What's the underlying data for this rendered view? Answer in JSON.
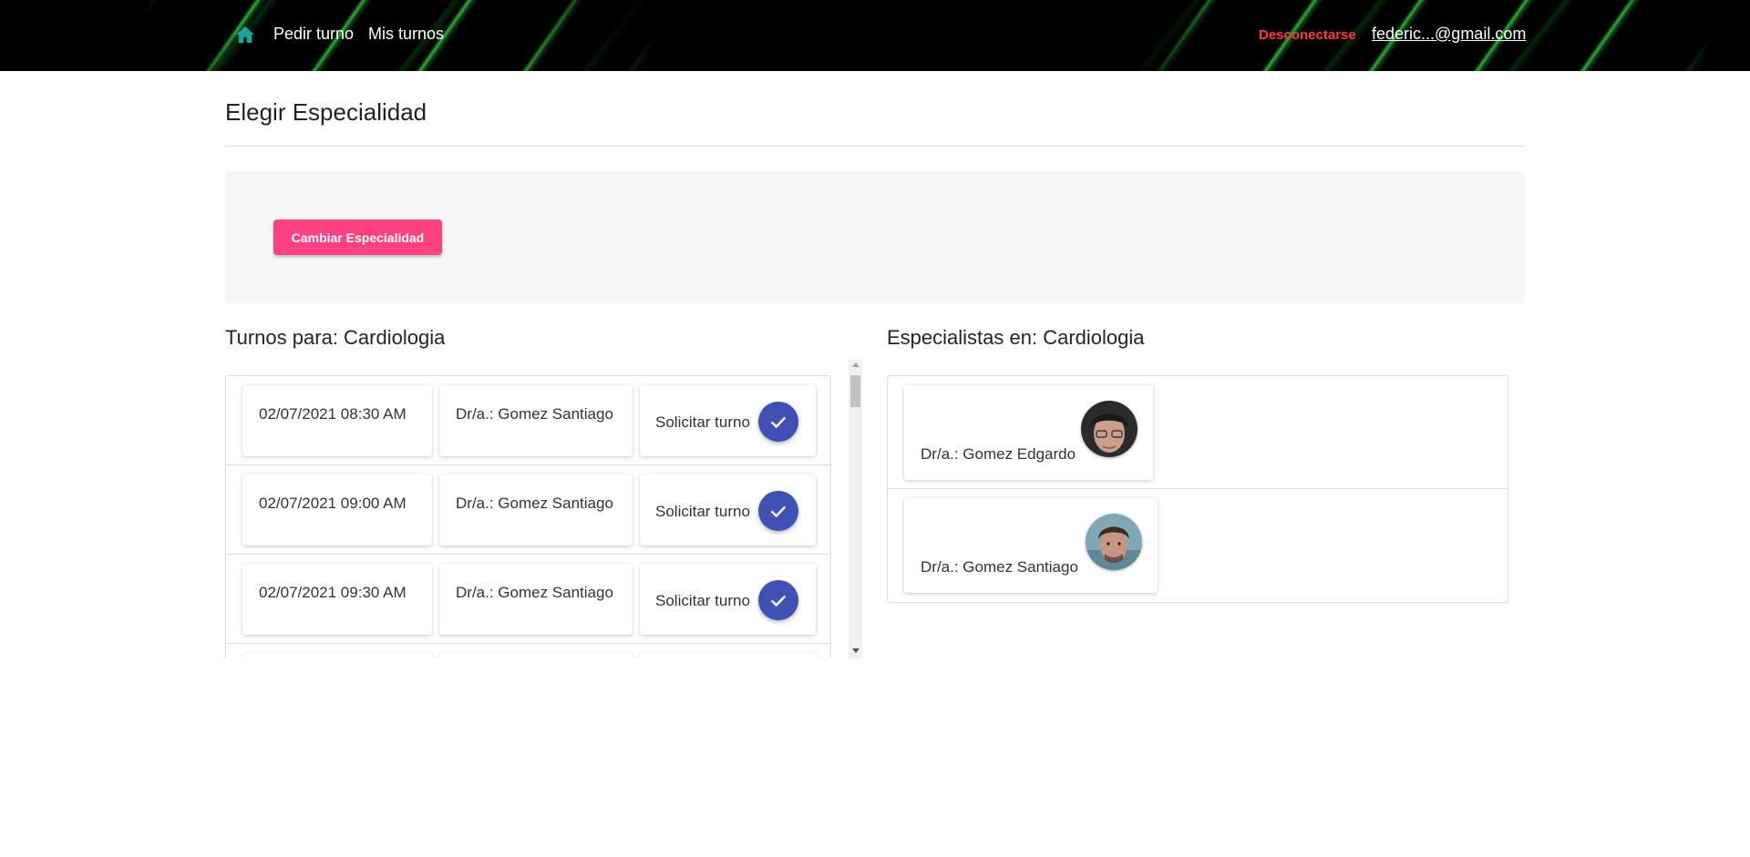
{
  "nav": {
    "home_icon": "home-icon",
    "pedir_turno": "Pedir turno",
    "mis_turnos": "Mis turnos",
    "logout": "Desconectarse",
    "user_email": "federic...@gmail.com"
  },
  "page": {
    "title": "Elegir Especialidad",
    "change_button": "Cambiar Especialidad"
  },
  "turnos": {
    "heading": "Turnos para: Cardiologia",
    "rows": [
      {
        "datetime": "02/07/2021 08:30 AM",
        "doctor": "Dr/a.: Gomez Santiago",
        "action": "Solicitar turno"
      },
      {
        "datetime": "02/07/2021 09:00 AM",
        "doctor": "Dr/a.: Gomez Santiago",
        "action": "Solicitar turno"
      },
      {
        "datetime": "02/07/2021 09:30 AM",
        "doctor": "Dr/a.: Gomez Santiago",
        "action": "Solicitar turno"
      }
    ]
  },
  "especialistas": {
    "heading": "Especialistas en: Cardiologia",
    "items": [
      {
        "name": "Dr/a.: Gomez Edgardo"
      },
      {
        "name": "Dr/a.: Gomez Santiago"
      }
    ]
  },
  "colors": {
    "accent_pink": "#ff4081",
    "check_blue": "#3f51b5",
    "logout_red": "#ff3b3b",
    "home_teal": "#1aa5a0"
  }
}
